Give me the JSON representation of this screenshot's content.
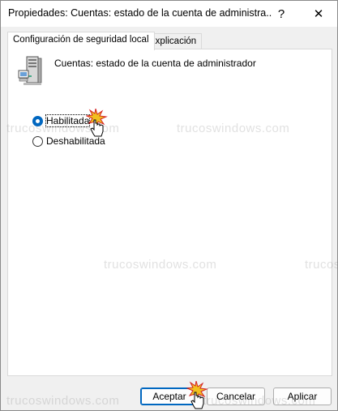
{
  "window": {
    "title": "Propiedades: Cuentas: estado de la cuenta de administra...",
    "help_glyph": "?",
    "close_glyph": "✕"
  },
  "tabs": [
    {
      "label": "Configuración de seguridad local",
      "active": true
    },
    {
      "label": "Explicación",
      "active": false
    }
  ],
  "policy": {
    "name": "Cuentas: estado de la cuenta de administrador",
    "icon": "server-computer-icon"
  },
  "options": [
    {
      "label": "Habilitada",
      "checked": true
    },
    {
      "label": "Deshabilitada",
      "checked": false
    }
  ],
  "buttons": {
    "ok": "Aceptar",
    "cancel": "Cancelar",
    "apply": "Aplicar"
  },
  "watermark": "trucoswindows.com",
  "colors": {
    "accent": "#0067c0",
    "click_burst": "#f0c020"
  }
}
